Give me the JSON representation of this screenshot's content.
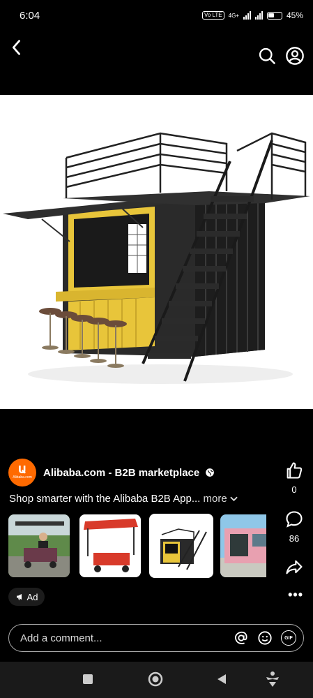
{
  "status_bar": {
    "time": "6:04",
    "network_badge": "Vo LTE",
    "network_type": "4G+",
    "battery": "45%"
  },
  "post": {
    "page_name": "Alibaba.com - B2B marketplace",
    "logo_text": "Alibaba.com",
    "caption": "Shop smarter with the Alibaba B2B App...",
    "more_label": "more",
    "like_count": "0",
    "comment_count": "86",
    "ad_label": "Ad"
  },
  "carousel": {
    "items": [
      "folding-wagon-with-man",
      "red-cart-kiosk",
      "container-kiosk",
      "pink-container"
    ],
    "selected_index": 2
  },
  "comment": {
    "placeholder": "Add a comment..."
  },
  "icons": {
    "back": "back-arrow-icon",
    "search": "search-icon",
    "profile": "profile-icon",
    "like": "thumbs-up-icon",
    "comment": "comment-bubble-icon",
    "share": "share-arrow-icon",
    "mention": "at-sign-icon",
    "emoji": "emoji-icon",
    "gif": "GIF"
  }
}
